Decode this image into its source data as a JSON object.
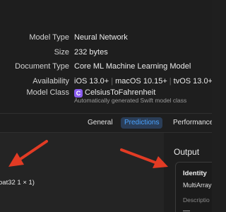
{
  "metadata": {
    "rows": [
      {
        "key": "Model Type",
        "value": "Neural Network"
      },
      {
        "key": "Size",
        "value": "232 bytes"
      },
      {
        "key": "Document Type",
        "value": "Core ML Machine Learning Model"
      }
    ],
    "availability": {
      "key": "Availability",
      "platforms": [
        "iOS 13.0+",
        "macOS 10.15+",
        "tvOS 13.0+"
      ],
      "separator": "|"
    },
    "model_class": {
      "key": "Model Class",
      "icon_letter": "C",
      "name": "CelsiusToFahrenheit",
      "subtitle": "Automatically generated Swift model class"
    }
  },
  "tabs": [
    {
      "label": "General",
      "active": false
    },
    {
      "label": "Predictions",
      "active": true
    },
    {
      "label": "Performance",
      "active": false
    }
  ],
  "input": {
    "type_text": "oat32 1 × 1)"
  },
  "output": {
    "title": "Output",
    "name": "Identity",
    "type": "MultiArray",
    "description_label": "Descriptio",
    "description_value": "—"
  },
  "colors": {
    "accent": "#4aa3ff",
    "arrow": "#e23b24",
    "class_icon": "#8a5cf0"
  }
}
